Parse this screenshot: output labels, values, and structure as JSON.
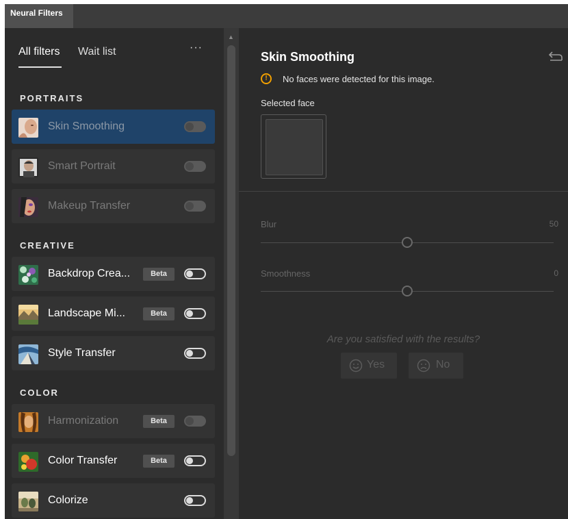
{
  "window": {
    "title": "Neural Filters"
  },
  "tabs": [
    {
      "label": "All filters"
    },
    {
      "label": "Wait list"
    }
  ],
  "more_label": "···",
  "sections": {
    "portraits": "PORTRAITS",
    "creative": "CREATIVE",
    "color": "COLOR"
  },
  "filters": [
    {
      "label": "Skin Smoothing",
      "state": "selected",
      "toggle": "off"
    },
    {
      "label": "Smart Portrait",
      "state": "disabled",
      "toggle": "off"
    },
    {
      "label": "Makeup Transfer",
      "state": "disabled",
      "toggle": "off"
    },
    {
      "label": "Backdrop Crea...",
      "badge": "Beta",
      "state": "enabled",
      "toggle": "off"
    },
    {
      "label": "Landscape Mi...",
      "badge": "Beta",
      "state": "enabled",
      "toggle": "off"
    },
    {
      "label": "Style Transfer",
      "state": "enabled",
      "toggle": "off"
    },
    {
      "label": "Harmonization",
      "badge": "Beta",
      "state": "disabled",
      "toggle": "off"
    },
    {
      "label": "Color Transfer",
      "badge": "Beta",
      "state": "enabled",
      "toggle": "off"
    },
    {
      "label": "Colorize",
      "state": "enabled",
      "toggle": "off"
    }
  ],
  "detail": {
    "title": "Skin Smoothing",
    "warning": "No faces were detected for this image.",
    "selected_face_label": "Selected face",
    "sliders": [
      {
        "label": "Blur",
        "value": "50",
        "level": 0.5
      },
      {
        "label": "Smoothness",
        "value": "0",
        "level": 0.5
      }
    ],
    "feedback_question": "Are you satisfied with the results?",
    "yes_label": "Yes",
    "no_label": "No"
  },
  "colors": {
    "selected_bg": "#1f4369",
    "warning": "#f2a000",
    "panel_bg": "#2b2b2b"
  }
}
